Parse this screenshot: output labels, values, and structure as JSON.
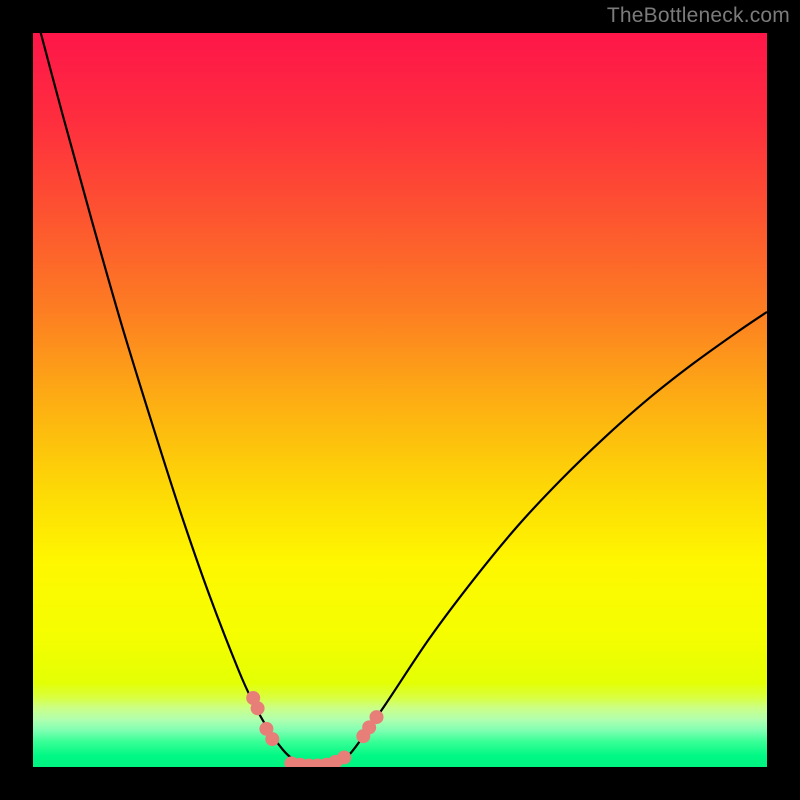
{
  "watermark": "TheBottleneck.com",
  "colors": {
    "background": "#000000",
    "curve_stroke": "#000000",
    "marker": "#e77f78",
    "gradient_stops": [
      {
        "offset": 0.0,
        "color": "#fe1649"
      },
      {
        "offset": 0.12,
        "color": "#fe2e3e"
      },
      {
        "offset": 0.25,
        "color": "#fd5430"
      },
      {
        "offset": 0.38,
        "color": "#fd7e22"
      },
      {
        "offset": 0.5,
        "color": "#fdad13"
      },
      {
        "offset": 0.62,
        "color": "#fdd806"
      },
      {
        "offset": 0.72,
        "color": "#fef700"
      },
      {
        "offset": 0.82,
        "color": "#f5fe00"
      },
      {
        "offset": 0.885,
        "color": "#e4ff04"
      },
      {
        "offset": 0.905,
        "color": "#d9ff3f"
      },
      {
        "offset": 0.92,
        "color": "#caff89"
      },
      {
        "offset": 0.935,
        "color": "#b2ffae"
      },
      {
        "offset": 0.95,
        "color": "#80ffb2"
      },
      {
        "offset": 0.965,
        "color": "#3aff97"
      },
      {
        "offset": 0.985,
        "color": "#00f884"
      },
      {
        "offset": 1.0,
        "color": "#00f381"
      }
    ]
  },
  "chart_data": {
    "type": "line",
    "title": "",
    "xlabel": "",
    "ylabel": "",
    "xlim": [
      0,
      100
    ],
    "ylim": [
      0,
      100
    ],
    "grid": false,
    "legend": false,
    "series": [
      {
        "name": "bottleneck-curve",
        "x": [
          0,
          4,
          8,
          12,
          16,
          20,
          24,
          28,
          30,
          32,
          34,
          35.5,
          37,
          39,
          41,
          42.5,
          44,
          48,
          54,
          60,
          66,
          72,
          78,
          84,
          90,
          96,
          100
        ],
        "y": [
          104,
          89,
          74.5,
          60.5,
          47.5,
          35,
          23.5,
          13.2,
          8.8,
          5.2,
          2.4,
          1.0,
          0.3,
          0.0,
          0.3,
          1.2,
          2.8,
          8.5,
          17.5,
          25.5,
          32.8,
          39.2,
          45.0,
          50.3,
          55.0,
          59.3,
          62.0
        ]
      }
    ],
    "markers": {
      "name": "highlight-markers",
      "points": [
        {
          "x": 30.0,
          "y": 9.4
        },
        {
          "x": 30.6,
          "y": 8.0
        },
        {
          "x": 31.8,
          "y": 5.2
        },
        {
          "x": 32.6,
          "y": 3.8
        },
        {
          "x": 35.2,
          "y": 0.5
        },
        {
          "x": 36.4,
          "y": 0.3
        },
        {
          "x": 37.6,
          "y": 0.2
        },
        {
          "x": 38.8,
          "y": 0.2
        },
        {
          "x": 40.0,
          "y": 0.3
        },
        {
          "x": 41.2,
          "y": 0.7
        },
        {
          "x": 42.4,
          "y": 1.3
        },
        {
          "x": 45.0,
          "y": 4.2
        },
        {
          "x": 45.8,
          "y": 5.4
        },
        {
          "x": 46.8,
          "y": 6.8
        }
      ],
      "radius_px": 7
    }
  }
}
